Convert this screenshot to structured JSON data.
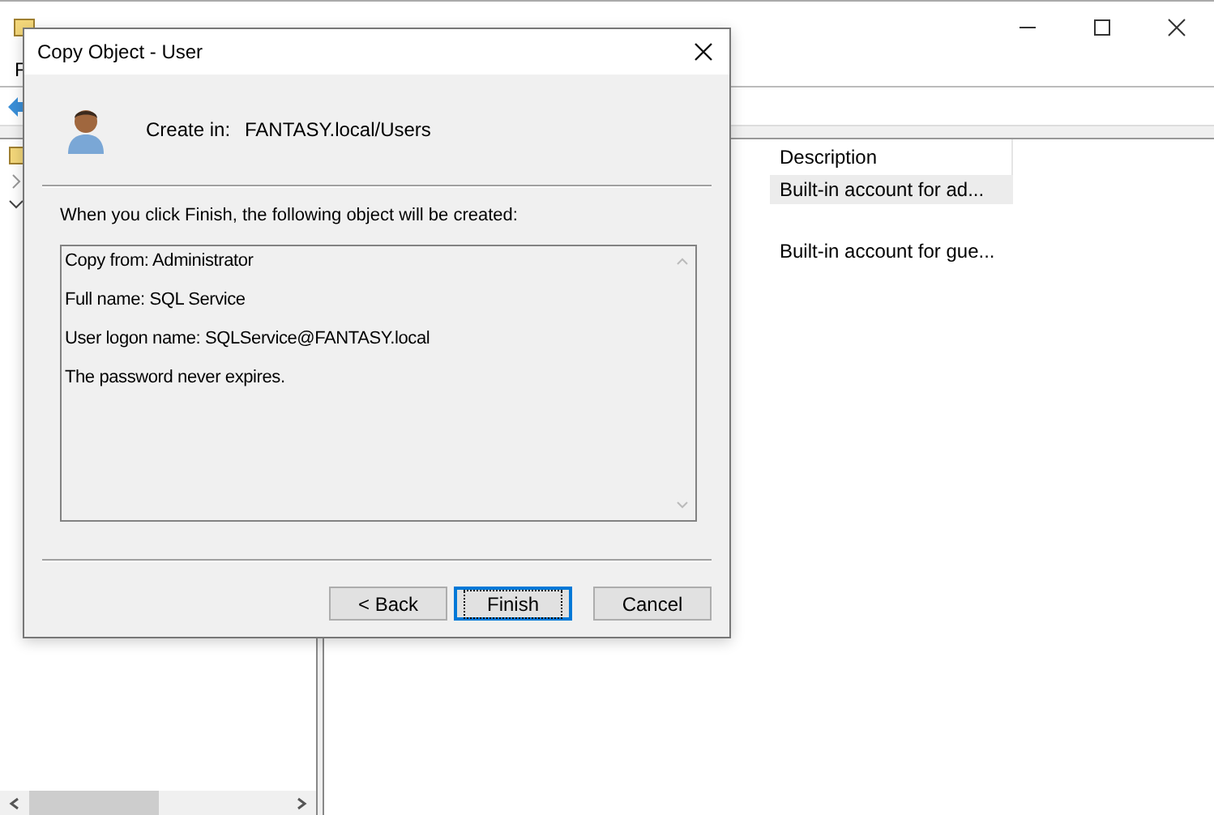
{
  "main_window": {
    "menu": [
      "F"
    ],
    "table": {
      "columns": [
        "Description"
      ],
      "rows": [
        {
          "description": "Built-in account for ad...",
          "selected": true
        },
        {
          "description": "Built-in account for gue...",
          "selected": false
        }
      ]
    }
  },
  "dialog": {
    "title": "Copy Object - User",
    "create_in_label": "Create in:",
    "create_in_value": "FANTASY.local/Users",
    "intro": "When you click Finish, the following object will be created:",
    "summary": [
      "Copy from: Administrator",
      "Full name: SQL Service",
      "User logon name: SQLService@FANTASY.local",
      "The password never expires."
    ],
    "buttons": [
      {
        "label": "< Back",
        "focused": false
      },
      {
        "label": "Finish",
        "focused": true
      },
      {
        "label": "Cancel",
        "focused": false
      }
    ]
  }
}
